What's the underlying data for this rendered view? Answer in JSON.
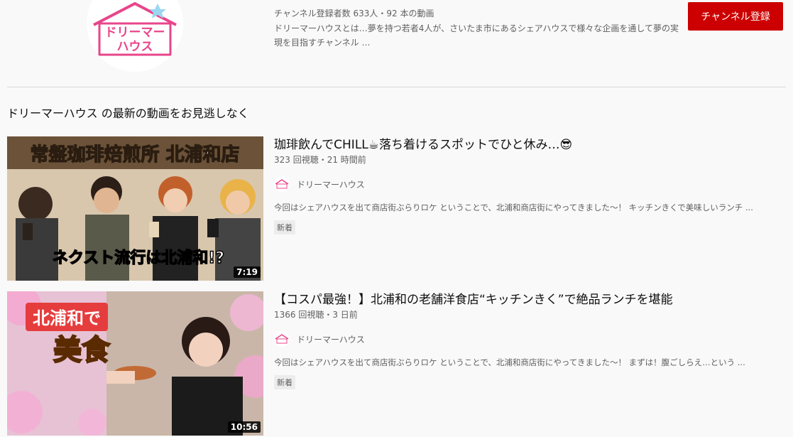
{
  "channel": {
    "stats": "チャンネル登録者数 633人・92 本の動画",
    "description": "ドリーマーハウスとは…夢を持つ若者4人が、さいたま市にあるシェアハウスで様々な企画を通して夢の実現を目指すチャンネル …",
    "subscribe_label": "チャンネル登録",
    "logo_text_1": "ドリーマー",
    "logo_text_2": "ハウス"
  },
  "section": {
    "title": "ドリーマーハウス の最新の動画をお見逃しなく"
  },
  "videos": [
    {
      "title": "珈琲飲んでCHILL☕落ち着けるスポットでひと休み…😎",
      "stats": "323 回視聴・21 時間前",
      "channel": "ドリーマーハウス",
      "description": "今回はシェアハウスを出て商店街ぶらりロケ ということで、北浦和商店街にやってきました〜！ キッチンきくで美味しいランチ ...",
      "badge": "新着",
      "duration": "7:19",
      "thumb_banner": "常盤珈琲焙煎所 北浦和店",
      "thumb_caption": "ネクスト流行は北浦和!?"
    },
    {
      "title": "【コスパ最強！】北浦和の老舗洋食店“キッチンきく”で絶品ランチを堪能",
      "stats": "1366 回視聴・3 日前",
      "channel": "ドリーマーハウス",
      "description": "今回はシェアハウスを出て商店街ぶらりロケ ということで、北浦和商店街にやってきました〜！ まずは！腹ごしらえ…という ...",
      "badge": "新着",
      "duration": "10:56",
      "thumb_text_1": "北浦和で",
      "thumb_text_2": "美食"
    }
  ],
  "colors": {
    "accent": "#cc0000",
    "brand_pink": "#e8458b"
  }
}
